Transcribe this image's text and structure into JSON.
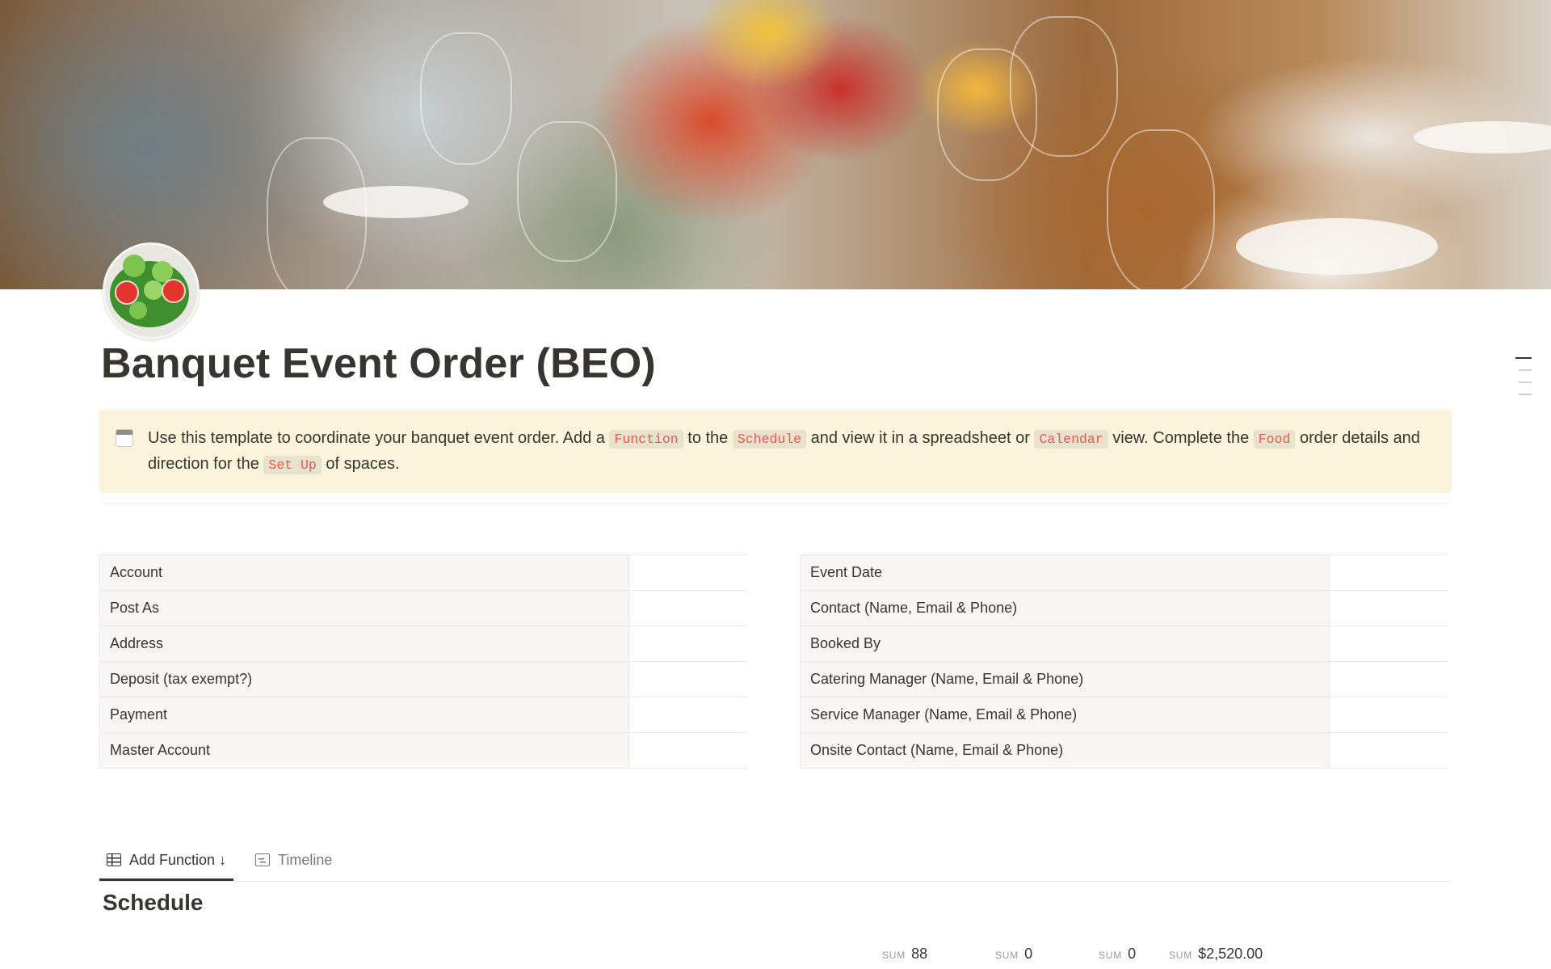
{
  "page": {
    "title": "Banquet Event Order (BEO)",
    "cover_icon": "salad-icon"
  },
  "callout": {
    "icon": "calendar-icon",
    "segments": [
      {
        "text": "Use this template to coordinate your banquet event order. Add a ",
        "code": false
      },
      {
        "text": "Function",
        "code": true
      },
      {
        "text": " to the ",
        "code": false
      },
      {
        "text": "Schedule",
        "code": true
      },
      {
        "text": " and view it in a spreadsheet or ",
        "code": false
      },
      {
        "text": "Calendar",
        "code": true
      },
      {
        "text": " view. Complete the ",
        "code": false
      },
      {
        "text": "Food",
        "code": true
      },
      {
        "text": " order details and direction for the ",
        "code": false
      },
      {
        "text": "Set Up",
        "code": true
      },
      {
        "text": " of spaces.",
        "code": false
      }
    ]
  },
  "left_table": [
    {
      "label": "Account",
      "value": ""
    },
    {
      "label": "Post As",
      "value": ""
    },
    {
      "label": "Address",
      "value": ""
    },
    {
      "label": "Deposit (tax exempt?)",
      "value": ""
    },
    {
      "label": "Payment",
      "value": ""
    },
    {
      "label": "Master Account",
      "value": ""
    }
  ],
  "right_table": [
    {
      "label": "Event Date",
      "value": ""
    },
    {
      "label": "Contact (Name, Email & Phone)",
      "value": ""
    },
    {
      "label": "Booked By",
      "value": ""
    },
    {
      "label": "Catering Manager (Name, Email & Phone)",
      "value": ""
    },
    {
      "label": "Service Manager (Name, Email & Phone)",
      "value": ""
    },
    {
      "label": "Onsite Contact (Name, Email & Phone)",
      "value": ""
    }
  ],
  "tabs": [
    {
      "label": "Add Function ↓",
      "icon": "table-icon",
      "active": true
    },
    {
      "label": "Timeline",
      "icon": "timeline-icon",
      "active": false
    }
  ],
  "schedule": {
    "heading": "Schedule",
    "sums": [
      {
        "label": "SUM",
        "value": "88"
      },
      {
        "label": "SUM",
        "value": "0"
      },
      {
        "label": "SUM",
        "value": "0"
      },
      {
        "label": "SUM",
        "value": "$2,520.00"
      }
    ]
  },
  "colors": {
    "callout_bg": "#fbf3db",
    "code_text": "#eb5757",
    "property_bg": "#f7f6f3",
    "text": "#37352f"
  }
}
